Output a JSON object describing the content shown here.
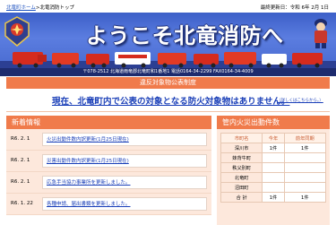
{
  "breadcrumb": {
    "home_label": "北竜町ホーム",
    "separator": ">",
    "current_label": "北竜消防トップ"
  },
  "last_updated": "最終更新日：令和 6年 2月 1日",
  "banner": {
    "title": "ようこそ北竜消防へ",
    "address": "〒078-2512 北海道雨竜郡北竜町和1番地1 電話0164-34-2299 FAX0164-34-4009"
  },
  "violation": {
    "heading": "違反対象物公表制度",
    "message": "現在、北竜町内で公表の対象となる防火対象物はありません。",
    "note": "（詳しくはこちらから。）"
  },
  "news": {
    "heading": "新着情報",
    "items": [
      {
        "date": "R6. 2. 1",
        "title": "火災出動件数内訳更新(1月25日現在)"
      },
      {
        "date": "R6. 2. 1",
        "title": "災害出動件数内訳更新(1月25日現在)"
      },
      {
        "date": "R6. 2. 1",
        "title": "応急手当協力事業所を更新しました。"
      },
      {
        "date": "R6. 1. 22",
        "title": "各種申請、届出書類を更新しました。"
      }
    ]
  },
  "fire_stats": {
    "heading": "管内火災出動件数",
    "columns": [
      "市町名",
      "今年",
      "前年同期"
    ],
    "rows": [
      {
        "name": "深川市",
        "this_year": "1件",
        "last_year": "1件"
      },
      {
        "name": "妹背牛町",
        "this_year": "",
        "last_year": ""
      },
      {
        "name": "秩父別町",
        "this_year": "",
        "last_year": ""
      },
      {
        "name": "北竜町",
        "this_year": "",
        "last_year": ""
      },
      {
        "name": "沼田町",
        "this_year": "",
        "last_year": ""
      },
      {
        "name": "合 計",
        "this_year": "1件",
        "last_year": "1件"
      }
    ]
  },
  "colors": {
    "accent": "#f07b4b",
    "link": "#1a3fb8",
    "banner": "#4466cc",
    "panel_bg": "#fde8dc"
  }
}
